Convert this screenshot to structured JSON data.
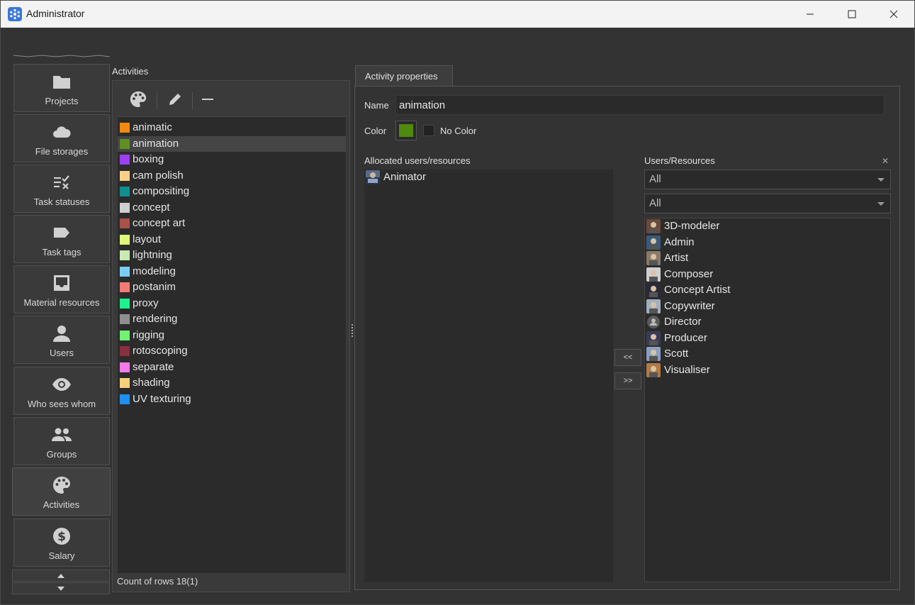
{
  "window": {
    "title": "Administrator"
  },
  "sidebar": {
    "items": [
      {
        "label": "Projects",
        "icon": "folder-icon"
      },
      {
        "label": "File storages",
        "icon": "cloud-icon"
      },
      {
        "label": "Task statuses",
        "icon": "checklist-icon"
      },
      {
        "label": "Task tags",
        "icon": "tag-icon"
      },
      {
        "label": "Material resources",
        "icon": "inbox-icon"
      },
      {
        "label": "Users",
        "icon": "person-icon"
      },
      {
        "label": "Who sees whom",
        "icon": "eye-icon"
      },
      {
        "label": "Groups",
        "icon": "group-icon"
      },
      {
        "label": "Activities",
        "icon": "palette-icon"
      },
      {
        "label": "Salary",
        "icon": "dollar-icon"
      }
    ],
    "active": "Activities"
  },
  "activities": {
    "title": "Activities",
    "items": [
      {
        "name": "animatic",
        "color": "#f28a12"
      },
      {
        "name": "animation",
        "color": "#5f8f25"
      },
      {
        "name": "boxing",
        "color": "#9d3ff5"
      },
      {
        "name": "cam polish",
        "color": "#f7d08a"
      },
      {
        "name": "compositing",
        "color": "#0f8f8f"
      },
      {
        "name": "concept",
        "color": "#cfcfcf"
      },
      {
        "name": "concept art",
        "color": "#a8524a"
      },
      {
        "name": "layout",
        "color": "#dff77a"
      },
      {
        "name": "lightning",
        "color": "#c9eab0"
      },
      {
        "name": "modeling",
        "color": "#7ccdf5"
      },
      {
        "name": "postanim",
        "color": "#f57a74"
      },
      {
        "name": "proxy",
        "color": "#1ef28f"
      },
      {
        "name": "rendering",
        "color": "#8f8f8f"
      },
      {
        "name": "rigging",
        "color": "#72f272"
      },
      {
        "name": "rotoscoping",
        "color": "#8a2f3f"
      },
      {
        "name": "separate",
        "color": "#f57ae8"
      },
      {
        "name": "shading",
        "color": "#f7d07a"
      },
      {
        "name": "UV texturing",
        "color": "#1f8ff2"
      }
    ],
    "selected": "animation",
    "count": "Count of rows 18(1)"
  },
  "properties": {
    "tab": "Activity properties",
    "name_label": "Name",
    "name_value": "animation",
    "color_label": "Color",
    "color_value": "#4f8a10",
    "no_color_label": "No Color",
    "allocated_label": "Allocated users/resources",
    "allocated": [
      {
        "name": "Animator"
      }
    ],
    "move_left": "<<",
    "move_right": ">>",
    "resources_label": "Users/Resources",
    "filter1": "All",
    "filter2": "All",
    "resources": [
      {
        "name": "3D-modeler"
      },
      {
        "name": "Admin"
      },
      {
        "name": "Artist"
      },
      {
        "name": "Composer"
      },
      {
        "name": "Concept Artist"
      },
      {
        "name": "Copywriter"
      },
      {
        "name": "Director"
      },
      {
        "name": "Producer"
      },
      {
        "name": "Scott"
      },
      {
        "name": "Visualiser"
      }
    ]
  }
}
